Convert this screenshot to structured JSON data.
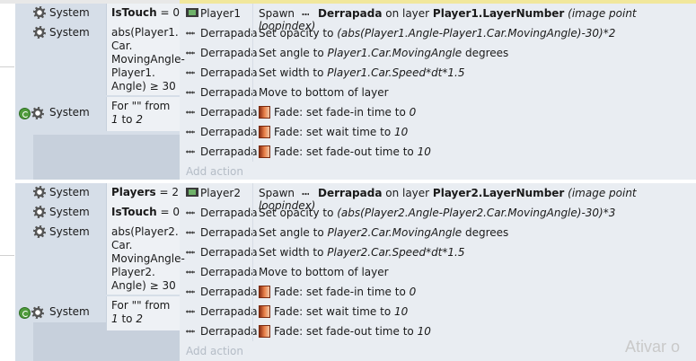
{
  "events": [
    {
      "conditions": [
        {
          "icon": "gear-icon",
          "object": "System",
          "expr_parts": [
            {
              "t": "IsTouch",
              "b": true
            },
            {
              "t": " = 0"
            }
          ]
        },
        {
          "icon": "gear-icon",
          "object": "System",
          "expr_text": "abs(Player1.\nCar.\nMovingAngle-\nPlayer1.\nAngle) ≥ 30"
        },
        {
          "icon": "loop-gear-icon",
          "object": "System",
          "expr_parts": [
            {
              "t": "For \"\" from\n"
            },
            {
              "t": "1",
              "i": true
            },
            {
              "t": " to "
            },
            {
              "t": "2",
              "i": true
            }
          ]
        }
      ],
      "actions": [
        {
          "icon": "sprite-icon",
          "object": "Player1",
          "desc": [
            {
              "t": "Spawn  "
            },
            {
              "dots": true
            },
            {
              "t": " Derrapada",
              "b": true
            },
            {
              "t": " on layer "
            },
            {
              "t": "Player1.LayerNumber",
              "b": true
            },
            {
              "t": " (image point loopindex)",
              "i": true
            }
          ]
        },
        {
          "icon": "dots-icon",
          "object": "Derrapada",
          "desc": [
            {
              "t": "Set opacity to "
            },
            {
              "t": "(abs(Player1.Angle-Player1.Car.MovingAngle)-30)*2",
              "i": true
            }
          ]
        },
        {
          "icon": "dots-icon",
          "object": "Derrapada",
          "desc": [
            {
              "t": "Set angle to "
            },
            {
              "t": "Player1.Car.MovingAngle",
              "i": true
            },
            {
              "t": "  degrees"
            }
          ]
        },
        {
          "icon": "dots-icon",
          "object": "Derrapada",
          "desc": [
            {
              "t": "Set width to "
            },
            {
              "t": "Player1.Car.Speed*dt*1.5",
              "i": true
            }
          ]
        },
        {
          "icon": "dots-icon",
          "object": "Derrapada",
          "desc": [
            {
              "t": "Move to bottom of layer"
            }
          ]
        },
        {
          "icon": "dots-icon",
          "object": "Derrapada",
          "desc": [
            {
              "fade": true
            },
            {
              "t": "Fade: set fade-in time to "
            },
            {
              "t": "0",
              "i": true
            }
          ]
        },
        {
          "icon": "dots-icon",
          "object": "Derrapada",
          "desc": [
            {
              "fade": true
            },
            {
              "t": "Fade: set wait time to "
            },
            {
              "t": "10",
              "i": true
            }
          ]
        },
        {
          "icon": "dots-icon",
          "object": "Derrapada",
          "desc": [
            {
              "fade": true
            },
            {
              "t": "Fade: set fade-out time to "
            },
            {
              "t": "10",
              "i": true
            }
          ]
        }
      ],
      "add_action": "Add action"
    },
    {
      "conditions": [
        {
          "icon": "gear-icon",
          "object": "System",
          "expr_parts": [
            {
              "t": "Players",
              "b": true
            },
            {
              "t": " = 2"
            }
          ]
        },
        {
          "icon": "gear-icon",
          "object": "System",
          "expr_parts": [
            {
              "t": "IsTouch",
              "b": true
            },
            {
              "t": " = 0"
            }
          ]
        },
        {
          "icon": "gear-icon",
          "object": "System",
          "expr_text": "abs(Player2.\nCar.\nMovingAngle-\nPlayer2.\nAngle) ≥ 30"
        },
        {
          "icon": "loop-gear-icon",
          "object": "System",
          "expr_parts": [
            {
              "t": "For \"\" from\n"
            },
            {
              "t": "1",
              "i": true
            },
            {
              "t": " to "
            },
            {
              "t": "2",
              "i": true
            }
          ]
        }
      ],
      "actions": [
        {
          "icon": "sprite-icon",
          "object": "Player2",
          "desc": [
            {
              "t": "Spawn  "
            },
            {
              "dots": true
            },
            {
              "t": " Derrapada",
              "b": true
            },
            {
              "t": " on layer "
            },
            {
              "t": "Player2.LayerNumber",
              "b": true
            },
            {
              "t": " (image point loopindex)",
              "i": true
            }
          ]
        },
        {
          "icon": "dots-icon",
          "object": "Derrapada",
          "desc": [
            {
              "t": "Set opacity to "
            },
            {
              "t": "(abs(Player2.Angle-Player2.Car.MovingAngle)-30)*3",
              "i": true
            }
          ]
        },
        {
          "icon": "dots-icon",
          "object": "Derrapada",
          "desc": [
            {
              "t": "Set angle to "
            },
            {
              "t": "Player2.Car.MovingAngle",
              "i": true
            },
            {
              "t": "  degrees"
            }
          ]
        },
        {
          "icon": "dots-icon",
          "object": "Derrapada",
          "desc": [
            {
              "t": "Set width to "
            },
            {
              "t": "Player2.Car.Speed*dt*1.5",
              "i": true
            }
          ]
        },
        {
          "icon": "dots-icon",
          "object": "Derrapada",
          "desc": [
            {
              "t": "Move to bottom of layer"
            }
          ]
        },
        {
          "icon": "dots-icon",
          "object": "Derrapada",
          "desc": [
            {
              "fade": true
            },
            {
              "t": "Fade: set fade-in time to "
            },
            {
              "t": "0",
              "i": true
            }
          ]
        },
        {
          "icon": "dots-icon",
          "object": "Derrapada",
          "desc": [
            {
              "fade": true
            },
            {
              "t": "Fade: set wait time to "
            },
            {
              "t": "10",
              "i": true
            }
          ]
        },
        {
          "icon": "dots-icon",
          "object": "Derrapada",
          "desc": [
            {
              "fade": true
            },
            {
              "t": "Fade: set fade-out time to "
            },
            {
              "t": "10",
              "i": true
            }
          ]
        }
      ],
      "add_action": "Add action"
    }
  ],
  "watermark": "Ativar o"
}
